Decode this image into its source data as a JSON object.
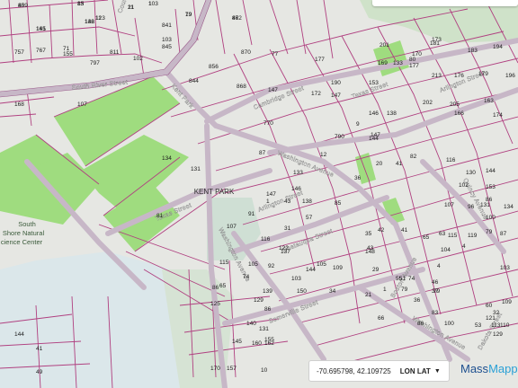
{
  "map": {
    "streets": [
      {
        "id": "south-river-street",
        "label": "South River Street"
      },
      {
        "id": "kent-park-road",
        "label": "Kent Park"
      },
      {
        "id": "cambridge-street",
        "label": "Cambridge Street"
      },
      {
        "id": "texas-street-ne",
        "label": "Texas Street"
      },
      {
        "id": "arlington-street-ne",
        "label": "Arlington Street"
      },
      {
        "id": "washington-avenue",
        "label": "Washington Avenue"
      },
      {
        "id": "arlington-street",
        "label": "Arlington Street"
      },
      {
        "id": "texas-street-w",
        "label": "Texas Street"
      },
      {
        "id": "chatauqua-street",
        "label": "Chatauqua Street"
      },
      {
        "id": "washington-avenue-s",
        "label": "Washington Avenue"
      },
      {
        "id": "somerville-street",
        "label": "Somerville Street"
      },
      {
        "id": "washington-avenue-se",
        "label": "Washington Avenue"
      },
      {
        "id": "dakota-street",
        "label": "Dakota Street"
      },
      {
        "id": "boston-avenue",
        "label": "Boston Avenue"
      },
      {
        "id": "quincy-avenue",
        "label": "Quincy Avenue"
      },
      {
        "id": "court-top",
        "label": "Court"
      }
    ],
    "places": [
      {
        "id": "kent-park",
        "label": "KENT PARK"
      },
      {
        "id": "nature-center",
        "lines": [
          "South",
          "Shore Natural",
          "cience Center"
        ]
      }
    ],
    "parcels": [
      "859",
      "103",
      "83",
      "21",
      "872",
      "19",
      "11",
      "146",
      "165",
      "757",
      "767",
      "71",
      "155",
      "811",
      "797",
      "102",
      "845",
      "841",
      "103",
      "844",
      "856",
      "870",
      "77",
      "177",
      "868",
      "147",
      "172",
      "190",
      "147",
      "153",
      "133",
      "170",
      "181",
      "173",
      "183",
      "194",
      "201",
      "80",
      "169",
      "177",
      "213",
      "176",
      "179",
      "196",
      "202",
      "205",
      "163",
      "166",
      "174",
      "168",
      "107",
      "770",
      "790",
      "9",
      "146",
      "138",
      "144",
      "147",
      "134",
      "131",
      "133",
      "87",
      "12",
      "36",
      "20",
      "41",
      "82",
      "116",
      "130",
      "144",
      "153",
      "147",
      "138",
      "146",
      "85",
      "31",
      "57",
      "81",
      "107",
      "91",
      "1",
      "43",
      "35",
      "42",
      "41",
      "65",
      "63",
      "86",
      "96",
      "102",
      "100",
      "104",
      "115",
      "119",
      "79",
      "87",
      "107",
      "131",
      "134",
      "115",
      "105",
      "116",
      "122",
      "137",
      "144",
      "148",
      "43",
      "46",
      "51",
      "55",
      "65",
      "74",
      "92",
      "103",
      "105",
      "109",
      "66",
      "36",
      "32",
      "53",
      "60",
      "86",
      "86",
      "125",
      "129",
      "139",
      "150",
      "34",
      "21",
      "1",
      "79",
      "79",
      "74",
      "83",
      "86",
      "100",
      "103",
      "109",
      "110",
      "113",
      "121",
      "129",
      "144",
      "145",
      "155",
      "131",
      "140",
      "157",
      "170",
      "160",
      "162",
      "6",
      "41",
      "49",
      "10",
      "29",
      "37",
      "4",
      "4",
      "40",
      "1",
      "15",
      "11",
      "46",
      "79",
      "123",
      "132",
      "141"
    ],
    "features": {
      "ui_box_top_right": ""
    }
  },
  "coordinate_bar": {
    "coords": "-70.695798, 42.109725",
    "mode": "LON LAT",
    "caret": "▼"
  },
  "logo": {
    "part1": "Mass",
    "part2": "Mapper"
  }
}
